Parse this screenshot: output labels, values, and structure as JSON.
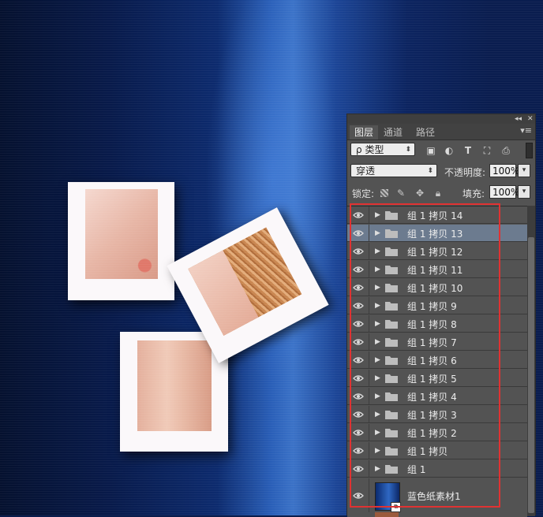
{
  "tabs": [
    "图层",
    "通道",
    "路径"
  ],
  "filter": {
    "kind_label": "类型",
    "kind_prefix": "ρ"
  },
  "blend": {
    "mode": "穿透",
    "opacity_label": "不透明度:",
    "opacity_value": "100%"
  },
  "lock": {
    "label": "锁定:",
    "fill_label": "填充:",
    "fill_value": "100%"
  },
  "layers": [
    "组 1 拷贝 14",
    "组 1 拷贝 13",
    "组 1 拷贝 12",
    "组 1 拷贝 11",
    "组 1 拷贝 10",
    "组 1 拷贝 9",
    "组 1 拷贝 8",
    "组 1 拷贝 7",
    "组 1 拷贝 6",
    "组 1 拷贝 5",
    "组 1 拷贝 4",
    "组 1 拷贝 3",
    "组 1 拷贝 2",
    "组 1 拷贝",
    "组 1"
  ],
  "selected_layer": 1,
  "image_layer": "蓝色纸素材1",
  "colors": {
    "highlight": "#e03232",
    "selection": "#6c7b8f"
  }
}
